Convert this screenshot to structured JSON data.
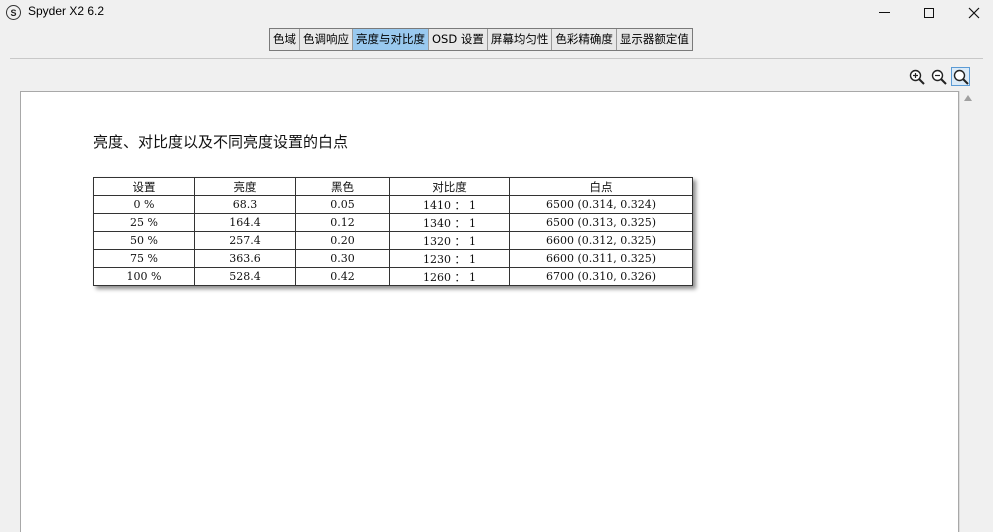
{
  "window": {
    "title": "Spyder X2 6.2",
    "icon_letter": "S"
  },
  "tabs": [
    {
      "label": "色域",
      "active": false
    },
    {
      "label": "色调响应",
      "active": false
    },
    {
      "label": "亮度与对比度",
      "active": true
    },
    {
      "label": "OSD 设置",
      "active": false
    },
    {
      "label": "屏幕均匀性",
      "active": false
    },
    {
      "label": "色彩精确度",
      "active": false
    },
    {
      "label": "显示器额定值",
      "active": false
    }
  ],
  "zoom_tools": [
    "zoom-in-icon",
    "zoom-out-icon",
    "zoom-fit-icon"
  ],
  "report": {
    "heading": "亮度、对比度以及不同亮度设置的白点",
    "table": {
      "headers": [
        "设置",
        "亮度",
        "黑色",
        "对比度",
        "白点"
      ],
      "rows": [
        [
          "0 %",
          "68.3",
          "0.05",
          "1410 ： 1",
          "6500 (0.314, 0.324)"
        ],
        [
          "25 %",
          "164.4",
          "0.12",
          "1340 ： 1",
          "6500 (0.313, 0.325)"
        ],
        [
          "50 %",
          "257.4",
          "0.20",
          "1320 ： 1",
          "6600 (0.312, 0.325)"
        ],
        [
          "75 %",
          "363.6",
          "0.30",
          "1230 ： 1",
          "6600 (0.311, 0.325)"
        ],
        [
          "100 %",
          "528.4",
          "0.42",
          "1260 ： 1",
          "6700 (0.310, 0.326)"
        ]
      ]
    }
  },
  "colors": {
    "active_tab": "#99c9ef",
    "background": "#f0f0f0"
  }
}
